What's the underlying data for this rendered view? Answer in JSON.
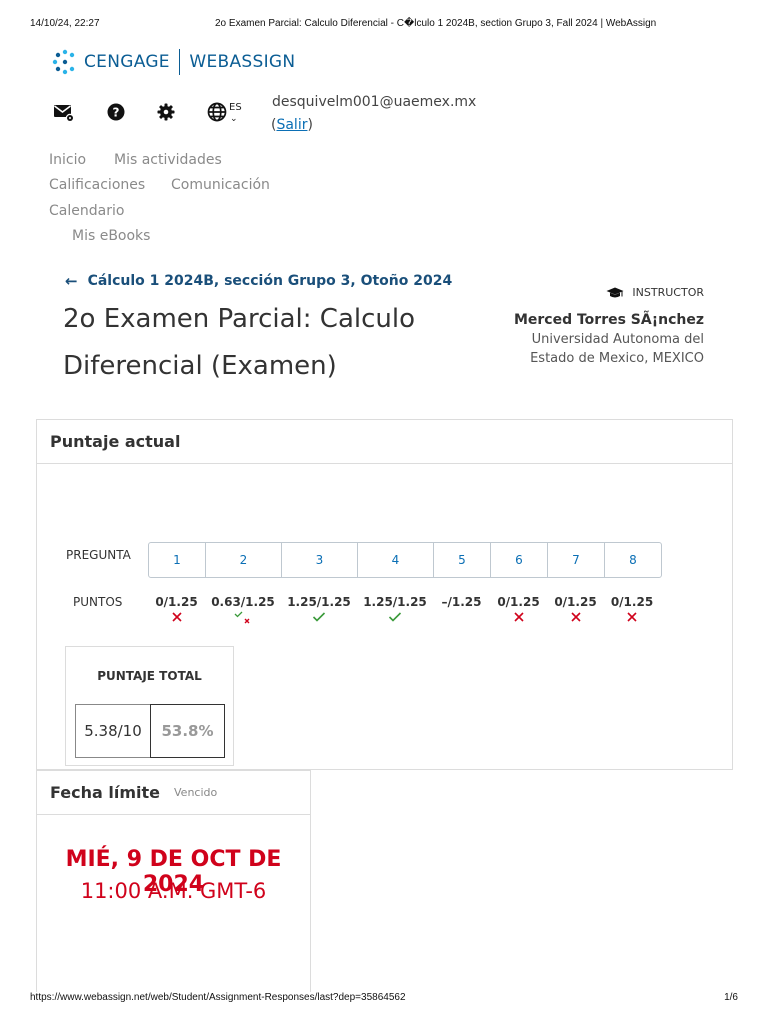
{
  "print": {
    "datetime": "14/10/24, 22:27",
    "title": "2o Examen Parcial: Calculo Diferencial - C�lculo 1 2024B, section Grupo 3, Fall 2024 | WebAssign",
    "url": "https://www.webassign.net/web/Student/Assignment-Responses/last?dep=35864562",
    "page": "1/6"
  },
  "brand": {
    "name1": "CENGAGE",
    "name2": "WEBASSIGN",
    "color": "#0b5d94",
    "accent": "#2bb3e8"
  },
  "utility": {
    "icons": [
      "mail-settings-icon",
      "help-icon",
      "gear-icon",
      "globe-icon"
    ],
    "language": "ES",
    "user_email": "desquivelm001@uaemex.mx",
    "logout_open": "(",
    "logout_label": "Salir",
    "logout_close": ")"
  },
  "nav": {
    "home": "Inicio",
    "activities": "Mis actividades",
    "grades": "Calificaciones",
    "communication": "Comunicación",
    "calendar": "Calendario",
    "ebooks": "Mis eBooks"
  },
  "course": {
    "breadcrumb": "Cálculo 1 2024B, sección Grupo 3, Otoño 2024",
    "title": "2o Examen Parcial: Calculo Diferencial (Examen)"
  },
  "instructor": {
    "role": "INSTRUCTOR",
    "name": "Merced Torres SÃ¡nchez",
    "institution": "Universidad Autonoma del Estado de Mexico, MEXICO"
  },
  "score": {
    "heading": "Puntaje actual",
    "question_label": "PREGUNTA",
    "points_label": "PUNTOS",
    "questions": [
      {
        "num": "1",
        "points": "0/1.25",
        "status": "incorrect"
      },
      {
        "num": "2",
        "points": "0.63/1.25",
        "status": "partial"
      },
      {
        "num": "3",
        "points": "1.25/1.25",
        "status": "correct"
      },
      {
        "num": "4",
        "points": "1.25/1.25",
        "status": "correct"
      },
      {
        "num": "5",
        "points": "–/1.25",
        "status": "none"
      },
      {
        "num": "6",
        "points": "0/1.25",
        "status": "incorrect"
      },
      {
        "num": "7",
        "points": "0/1.25",
        "status": "incorrect"
      },
      {
        "num": "8",
        "points": "0/1.25",
        "status": "incorrect"
      }
    ],
    "total_label": "PUNTAJE TOTAL",
    "total": "5.38/10",
    "percent": "53.8%",
    "colors": {
      "correct": "#3a9a3a",
      "incorrect": "#d0021b"
    }
  },
  "due": {
    "heading": "Fecha límite",
    "status": "Vencido",
    "date": "MIÉ, 9 DE OCT DE 2024",
    "time": "11:00 A.M. GMT-6",
    "color": "#d0021b"
  }
}
